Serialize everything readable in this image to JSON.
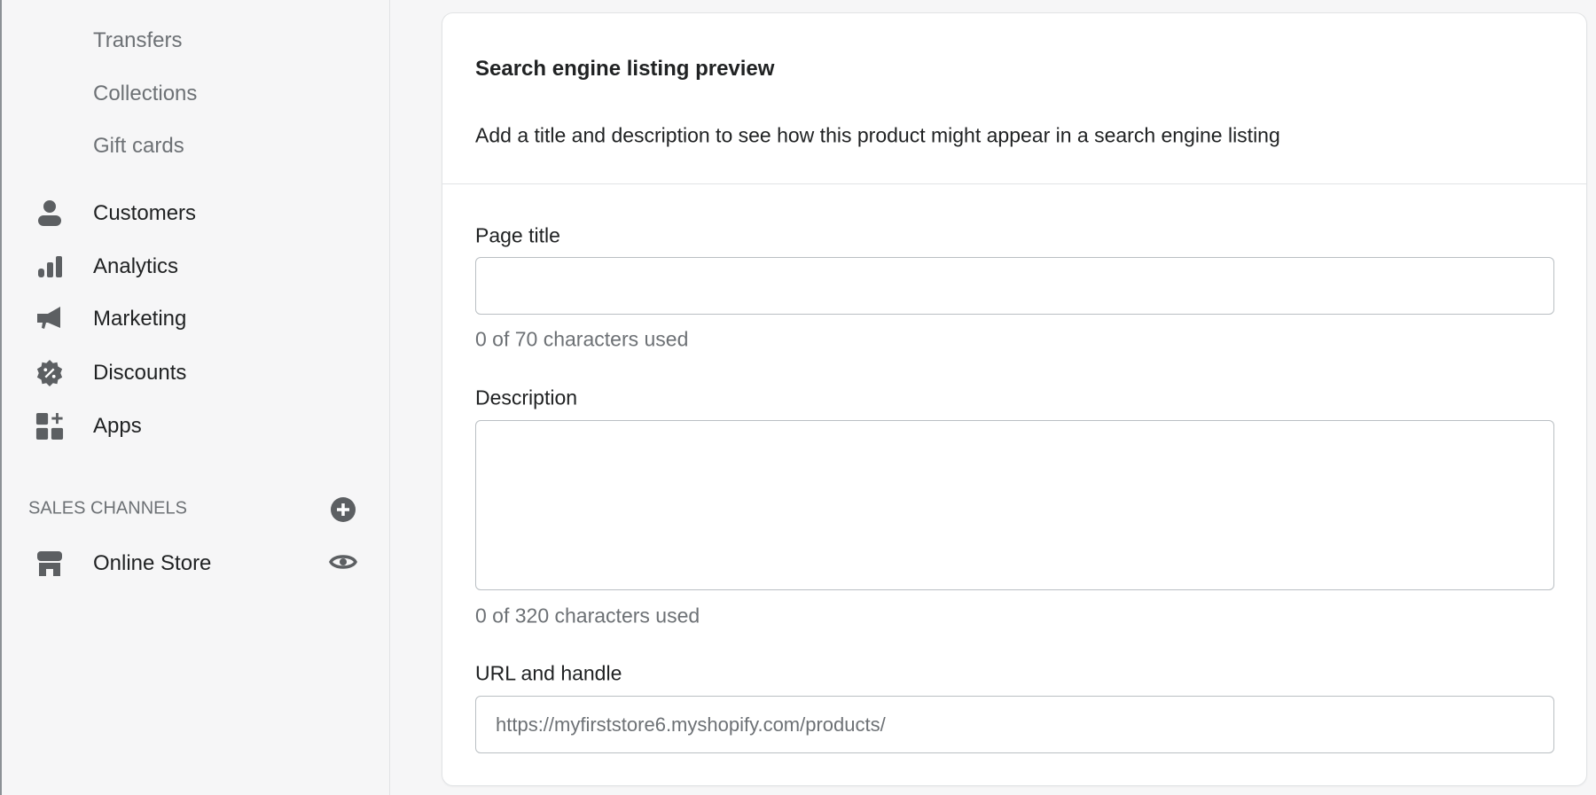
{
  "sidebar": {
    "sub_items": [
      "Transfers",
      "Collections",
      "Gift cards"
    ],
    "items": [
      {
        "label": "Customers",
        "icon": "person-icon"
      },
      {
        "label": "Analytics",
        "icon": "bar-chart-icon"
      },
      {
        "label": "Marketing",
        "icon": "megaphone-icon"
      },
      {
        "label": "Discounts",
        "icon": "discount-badge-icon"
      },
      {
        "label": "Apps",
        "icon": "apps-grid-icon"
      }
    ],
    "sales_channels_label": "SALES CHANNELS",
    "online_store": "Online Store"
  },
  "seo": {
    "title": "Search engine listing preview",
    "description": "Add a title and description to see how this product might appear in a search engine listing",
    "page_title_label": "Page title",
    "page_title_value": "",
    "page_title_counter": "0 of 70 characters used",
    "description_label": "Description",
    "description_value": "",
    "description_counter": "0 of 320 characters used",
    "url_label": "URL and handle",
    "url_value": "https://myfirststore6.myshopify.com/products/"
  }
}
